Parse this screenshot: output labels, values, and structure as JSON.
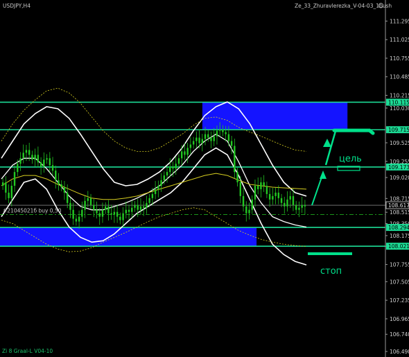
{
  "window": {
    "symbol_title": "USDJPY,H4",
    "indicator_title": "Ze_33_Zhuravlerezka_V-04-03_1bush",
    "order_label": "#21045021б buy 0,50",
    "footer_label": "Zi 8 Graal-L V04-10"
  },
  "annotations": {
    "target_label": "цель",
    "stop_label": "стоп"
  },
  "colors": {
    "background": "#000000",
    "candle": "#22c822",
    "zone": "#1414ff",
    "level_line": "#1cdc96",
    "envelope": "#ffffff",
    "ma_slow": "#d8d020",
    "annotation": "#00e08a"
  },
  "chart_data": {
    "type": "candlestick",
    "symbol": "USDJPY",
    "timeframe": "H4",
    "y_ticks": [
      111.295,
      111.025,
      110.755,
      110.485,
      110.215,
      110.03,
      109.525,
      109.255,
      109.02,
      108.715,
      108.515,
      108.35,
      108.175,
      108.02,
      107.755,
      107.505,
      107.235,
      106.965,
      106.74,
      106.49
    ],
    "ylim": [
      106.44,
      111.42
    ],
    "levels": [
      {
        "value": 110.115,
        "label": "110.115"
      },
      {
        "value": 109.715,
        "label": "109.715"
      },
      {
        "value": 109.173,
        "label": "109.173"
      },
      {
        "value": 108.617,
        "label": "108.617",
        "style": "current"
      },
      {
        "value": 108.294,
        "label": "108.294"
      },
      {
        "value": 108.021,
        "label": "108.021"
      }
    ],
    "zones": [
      {
        "from_bar": 0,
        "to_bar": 86,
        "low": 108.021,
        "high": 108.294
      },
      {
        "from_bar": 69,
        "to_bar": 117,
        "low": 109.715,
        "high": 110.115
      }
    ],
    "order_level": 108.48,
    "closes": [
      108.95,
      108.8,
      108.72,
      108.9,
      109.1,
      109.22,
      109.3,
      109.38,
      109.42,
      109.35,
      109.28,
      109.35,
      109.24,
      109.18,
      109.28,
      109.3,
      109.2,
      109.12,
      108.98,
      108.92,
      108.88,
      108.8,
      108.65,
      108.55,
      108.42,
      108.38,
      108.45,
      108.55,
      108.68,
      108.72,
      108.62,
      108.55,
      108.5,
      108.45,
      108.55,
      108.6,
      108.5,
      108.48,
      108.52,
      108.45,
      108.4,
      108.5,
      108.55,
      108.52,
      108.58,
      108.62,
      108.55,
      108.6,
      108.58,
      108.65,
      108.72,
      108.78,
      108.85,
      108.9,
      108.98,
      109.05,
      109.1,
      109.18,
      109.15,
      109.22,
      109.3,
      109.4,
      109.35,
      109.45,
      109.5,
      109.55,
      109.6,
      109.52,
      109.58,
      109.65,
      109.6,
      109.55,
      109.62,
      109.7,
      109.72,
      109.68,
      109.65,
      109.55,
      109.48,
      109.1,
      108.95,
      108.75,
      108.6,
      108.5,
      108.55,
      108.7,
      108.9,
      108.85,
      108.95,
      108.9,
      108.78,
      108.7,
      108.75,
      108.8,
      108.72,
      108.65,
      108.6,
      108.7,
      108.75,
      108.62,
      108.55,
      108.58,
      108.62,
      108.6
    ],
    "series": [
      {
        "name": "",
        "type": "envelope-upper",
        "values": [
          109.3,
          109.55,
          109.8,
          109.95,
          110.05,
          110.02,
          109.88,
          109.65,
          109.4,
          109.15,
          108.95,
          108.9,
          108.92,
          109.0,
          109.1,
          109.25,
          109.45,
          109.7,
          109.92,
          110.05,
          110.12,
          110.02,
          109.8,
          109.5,
          109.2,
          108.95,
          108.8,
          108.75
        ]
      },
      {
        "name": "",
        "type": "envelope-lower",
        "values": [
          108.45,
          108.7,
          108.95,
          109.0,
          108.85,
          108.55,
          108.3,
          108.15,
          108.08,
          108.1,
          108.2,
          108.35,
          108.5,
          108.6,
          108.7,
          108.8,
          108.95,
          109.15,
          109.35,
          109.45,
          109.35,
          109.05,
          108.7,
          108.35,
          108.05,
          107.9,
          107.8,
          107.75
        ]
      },
      {
        "name": "",
        "type": "envelope-inner",
        "values": [
          109.0,
          109.2,
          109.3,
          109.3,
          109.15,
          108.95,
          108.75,
          108.6,
          108.55,
          108.55,
          108.6,
          108.65,
          108.72,
          108.8,
          108.9,
          109.05,
          109.2,
          109.4,
          109.55,
          109.65,
          109.55,
          109.25,
          108.9,
          108.65,
          108.45,
          108.38,
          108.33,
          108.3
        ]
      },
      {
        "name": "",
        "type": "ma-slow",
        "values": [
          108.9,
          109.0,
          109.05,
          109.05,
          109.0,
          108.92,
          108.85,
          108.78,
          108.72,
          108.7,
          108.7,
          108.72,
          108.75,
          108.8,
          108.85,
          108.9,
          108.95,
          109.0,
          109.05,
          109.08,
          109.05,
          108.98,
          108.92,
          108.9,
          108.88,
          108.87,
          108.86,
          108.85
        ]
      },
      {
        "name": "",
        "type": "ma-upper-dashed",
        "values": [
          109.55,
          109.8,
          110.0,
          110.15,
          110.28,
          110.32,
          110.25,
          110.1,
          109.9,
          109.7,
          109.55,
          109.45,
          109.4,
          109.4,
          109.45,
          109.55,
          109.65,
          109.78,
          109.88,
          109.9,
          109.85,
          109.75,
          109.68,
          109.62,
          109.55,
          109.48,
          109.42,
          109.4
        ]
      },
      {
        "name": "",
        "type": "ma-lower-dashed",
        "values": [
          108.4,
          108.35,
          108.25,
          108.15,
          108.05,
          107.98,
          107.94,
          107.95,
          108.0,
          108.08,
          108.15,
          108.22,
          108.3,
          108.38,
          108.45,
          108.5,
          108.55,
          108.58,
          108.55,
          108.45,
          108.35,
          108.25,
          108.18,
          108.12,
          108.08,
          108.05,
          108.03,
          108.02
        ]
      }
    ],
    "grid": false,
    "legend": "none"
  }
}
